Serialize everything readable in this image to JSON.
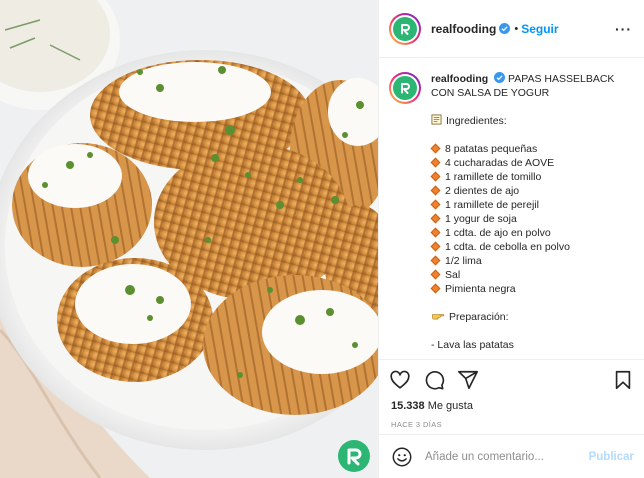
{
  "account": {
    "username": "realfooding",
    "follow_label": "Seguir",
    "separator": "•"
  },
  "caption": {
    "username": "realfooding",
    "title": "PAPAS HASSELBACK CON SALSA DE YOGUR",
    "ingredients_heading": "Ingredientes:",
    "ingredients": [
      "8 patatas pequeñas",
      "4 cucharadas de AOVE",
      "1 ramillete de tomillo",
      "2 dientes de ajo",
      "1 ramillete de perejil",
      "1 yogur de soja",
      "1 cdta. de ajo en polvo",
      "1 cdta. de cebolla en polvo",
      "1/2 lima",
      "Sal",
      "Pimienta negra"
    ],
    "preparation_heading": "Preparación:",
    "steps": [
      "- Lava las patatas"
    ]
  },
  "engagement": {
    "likes_count": "15.338",
    "likes_unit": "Me gusta",
    "time_ago": "HACE 3 DÍAS"
  },
  "comment": {
    "placeholder": "Añade un comentario...",
    "publish_label": "Publicar"
  },
  "icons": {
    "heart": "heart-icon",
    "comment": "comment-icon",
    "share": "share-icon",
    "bookmark": "bookmark-icon",
    "smile": "smile-icon",
    "verified": "verified-badge-icon",
    "notepad": "notepad-emoji-icon",
    "pointing_hand": "pointing-hand-emoji-icon",
    "bullet": "orange-diamond-emoji-icon"
  },
  "colors": {
    "brand_green": "#2bb673",
    "link_blue": "#0095f6",
    "publish_disabled": "#b3dbff",
    "bullet_orange": "#f0812f"
  }
}
